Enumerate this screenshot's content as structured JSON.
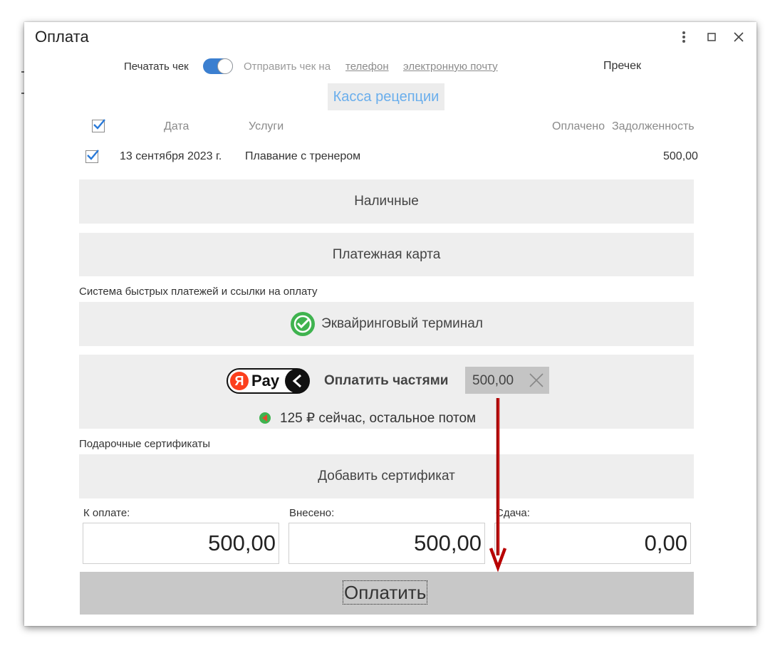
{
  "window": {
    "title": "Оплата"
  },
  "receipt": {
    "print_label": "Печатать чек",
    "print_on": true,
    "send_label": "Отправить чек на",
    "phone_link": "телефон",
    "email_link": "электронную почту",
    "recheck": "Пречек"
  },
  "cashdesk": "Касса рецепции",
  "table": {
    "headers": {
      "date": "Дата",
      "services": "Услуги",
      "paid": "Оплачено",
      "debt": "Задолженность"
    },
    "rows": [
      {
        "checked": true,
        "date": "13 сентября 2023 г.",
        "service": "Плавание с тренером",
        "paid": "",
        "debt": "500,00"
      }
    ]
  },
  "methods": {
    "cash": "Наличные",
    "card": "Платежная карта",
    "sbp_section": "Система быстрых платежей и ссылки на оплату",
    "terminal": "Эквайринговый терминал",
    "split": {
      "logo_ya": "Я",
      "logo_pay": "Pay",
      "title": "Оплатить частями",
      "amount": "500,00",
      "subtitle": "125 ₽ сейчас, остальное потом"
    },
    "cert_section": "Подарочные сертификаты",
    "cert_add": "Добавить сертификат"
  },
  "totals": {
    "due_label": "К оплате:",
    "due": "500,00",
    "paid_label": "Внесено:",
    "paid": "500,00",
    "change_label": "Сдача:",
    "change": "0,00"
  },
  "submit": "Оплатить",
  "colors": {
    "accent": "#3b7fd0",
    "button_bg": "#eeeeee",
    "submit_bg": "#c8c8c8",
    "cashdesk_text": "#6aaeec",
    "annotation_arrow": "#c00000"
  }
}
